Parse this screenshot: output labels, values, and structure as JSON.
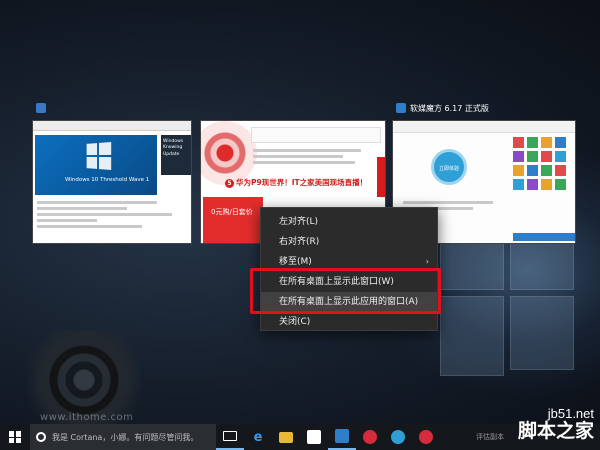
{
  "windows": [
    {
      "title": "",
      "content": {
        "hero_caption": "Windows 10 Threshold Wave 1",
        "side_caption": "Windows Knowing Update"
      }
    },
    {
      "title": "",
      "content": {
        "banner": "华为P9现世界！IT之家美国现场直播！",
        "ad": "0元购/日套价"
      }
    },
    {
      "title": "软媒魔方 6.17 正式版",
      "content": {
        "circle_label": "立即体验"
      }
    }
  ],
  "context_menu": {
    "items": [
      {
        "label": "左对齐(L)"
      },
      {
        "label": "右对齐(R)"
      },
      {
        "label": "移至(M)",
        "submenu": true
      },
      {
        "label": "在所有桌面上显示此窗口(W)"
      },
      {
        "label": "在所有桌面上显示此应用的窗口(A)"
      },
      {
        "label": "关闭(C)"
      }
    ],
    "arrow_glyph": "›",
    "highlighted_label": "在所有桌面上显示此应用的窗口(A)"
  },
  "taskbar": {
    "search_placeholder": "我是 Cortana，小娜。有问题尽管问我。",
    "right_text": "评估副本"
  },
  "watermark": {
    "site": "jb51.net",
    "name": "脚本之家",
    "bottom_text": "www.ithome.com"
  },
  "colors": {
    "menu_background": "#2b2b2b",
    "highlight_box": "#e0101c",
    "taskbar": "#14171b",
    "accent_blue": "#2e7ec9"
  }
}
